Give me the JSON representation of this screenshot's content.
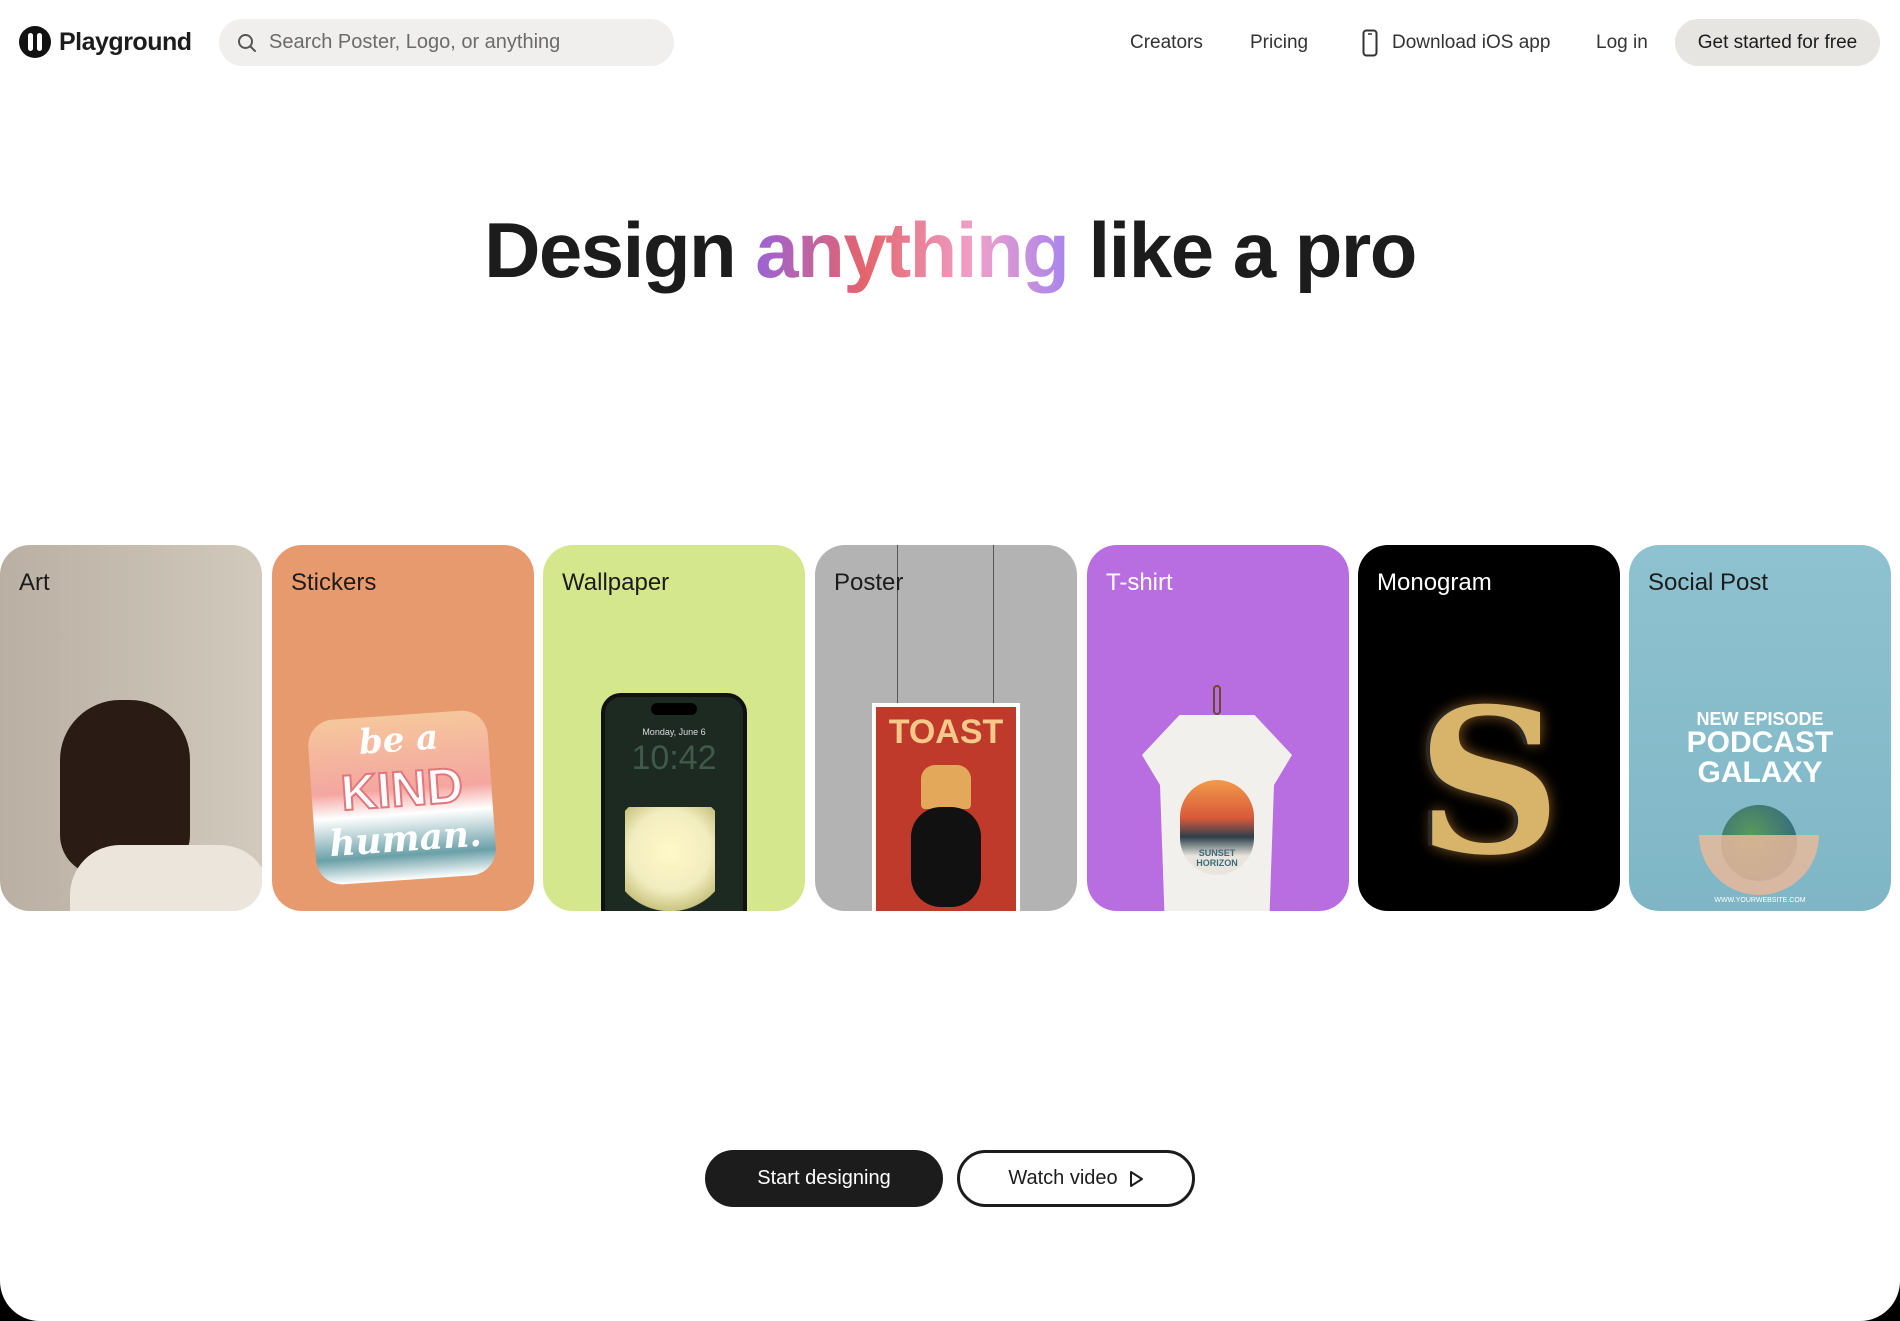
{
  "nav": {
    "brand": "Playground",
    "search_placeholder": "Search Poster, Logo, or anything",
    "links": [
      "Creators",
      "Pricing",
      "Download iOS app",
      "Log in"
    ],
    "cta": "Get started for free"
  },
  "hero": {
    "headline_before": "Design ",
    "headline_accent": "anything",
    "headline_after": " like a pro"
  },
  "cards": [
    {
      "label": "Art",
      "color": "#c6bcb0"
    },
    {
      "label": "Stickers",
      "color": "#e79a6e",
      "art": [
        "be a",
        "KIND",
        "human."
      ]
    },
    {
      "label": "Wallpaper",
      "color": "#d4e78c",
      "art": [
        "Monday, June 6",
        "10:42"
      ]
    },
    {
      "label": "Poster",
      "color": "#b3b3b3",
      "art": [
        "TOAST"
      ]
    },
    {
      "label": "T-shirt",
      "color": "#b86ee0",
      "art": [
        "SUNSET HORIZON"
      ]
    },
    {
      "label": "Monogram",
      "color": "#000000",
      "art": [
        "S"
      ]
    },
    {
      "label": "Social Post",
      "color": "#86bccc",
      "art": [
        "NEW EPISODE",
        "PODCAST",
        "GALAXY",
        "WWW.YOURWEBSITE.COM"
      ]
    }
  ],
  "actions": {
    "start": "Start designing",
    "watch": "Watch video"
  }
}
